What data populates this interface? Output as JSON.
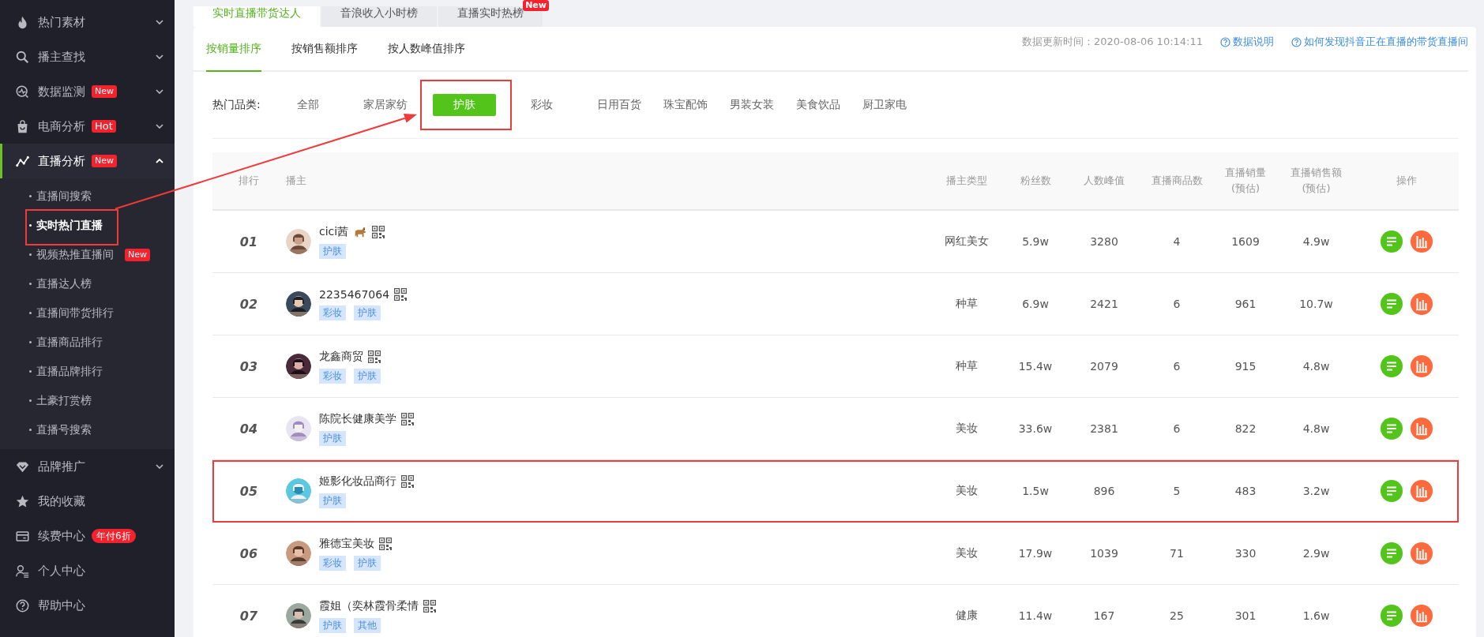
{
  "sidebar": {
    "items": [
      {
        "label": "热门素材",
        "expandable": true,
        "expanded": false,
        "selected": false
      },
      {
        "label": "播主查找",
        "expandable": true,
        "expanded": false,
        "selected": false
      },
      {
        "label": "数据监测",
        "badge": {
          "text": "New",
          "kind": "new"
        },
        "expandable": true,
        "expanded": false,
        "selected": false
      },
      {
        "label": "电商分析",
        "badge": {
          "text": "Hot",
          "kind": "hot"
        },
        "expandable": true,
        "expanded": false,
        "selected": false
      },
      {
        "label": "直播分析",
        "badge": {
          "text": "New",
          "kind": "new"
        },
        "expandable": true,
        "expanded": true,
        "selected": true,
        "children": [
          {
            "label": "直播间搜索",
            "selected": false,
            "highlighted": false
          },
          {
            "label": "实时热门直播",
            "selected": true,
            "highlighted": true
          },
          {
            "label": "视频热推直播间",
            "badge": {
              "text": "New",
              "kind": "new"
            },
            "selected": false,
            "highlighted": false
          },
          {
            "label": "直播达人榜",
            "selected": false,
            "highlighted": false
          },
          {
            "label": "直播间带货排行",
            "selected": false,
            "highlighted": false
          },
          {
            "label": "直播商品排行",
            "selected": false,
            "highlighted": false
          },
          {
            "label": "直播品牌排行",
            "selected": false,
            "highlighted": false
          },
          {
            "label": "土豪打赏榜",
            "selected": false,
            "highlighted": false
          },
          {
            "label": "直播号搜索",
            "selected": false,
            "highlighted": false
          }
        ]
      },
      {
        "label": "品牌推广",
        "expandable": true,
        "expanded": false,
        "selected": false
      },
      {
        "label": "我的收藏",
        "expandable": false,
        "selected": false
      },
      {
        "label": "续费中心",
        "badge": {
          "text": "年付6折",
          "kind": "promo"
        },
        "expandable": false,
        "selected": false
      },
      {
        "label": "个人中心",
        "expandable": false,
        "selected": false
      },
      {
        "label": "帮助中心",
        "expandable": false,
        "selected": false
      }
    ]
  },
  "tabs": [
    {
      "label": "实时直播带货达人",
      "selected": true
    },
    {
      "label": "音浪收入小时榜",
      "selected": false
    },
    {
      "label": "直播实时热榜",
      "selected": false,
      "badge": "New"
    }
  ],
  "sort_tabs": [
    {
      "label": "按销量排序",
      "selected": true
    },
    {
      "label": "按销售额排序",
      "selected": false
    },
    {
      "label": "按人数峰值排序",
      "selected": false
    }
  ],
  "update_info": "数据更新时间：2020-08-06 10:14:11",
  "help_links": [
    "数据说明",
    "如何发现抖音正在直播的带货直播间"
  ],
  "categories": {
    "label": "热门品类:",
    "items": [
      {
        "label": "全部",
        "selected": false,
        "highlighted": false
      },
      {
        "label": "家居家纺",
        "selected": false,
        "highlighted": false
      },
      {
        "label": "护肤",
        "selected": true,
        "highlighted": true
      },
      {
        "label": "彩妆",
        "selected": false,
        "highlighted": false
      },
      {
        "label": "日用百货",
        "selected": false,
        "highlighted": false
      },
      {
        "label": "珠宝配饰",
        "selected": false,
        "highlighted": false
      },
      {
        "label": "男装女装",
        "selected": false,
        "highlighted": false
      },
      {
        "label": "美食饮品",
        "selected": false,
        "highlighted": false
      },
      {
        "label": "厨卫家电",
        "selected": false,
        "highlighted": false
      }
    ]
  },
  "table": {
    "columns": [
      "排行",
      "播主",
      "播主类型",
      "粉丝数",
      "人数峰值",
      "直播商品数",
      "直播销量\n(预估)",
      "直播销售额\n(预估)",
      "操作"
    ],
    "rows": [
      {
        "rank": "01",
        "name": "cici茜",
        "emoji_icon": true,
        "tags": [
          "护肤"
        ],
        "type": "网红美女",
        "fans": "5.9w",
        "peak": "3280",
        "products": "4",
        "sales": "1609",
        "revenue": "4.9w",
        "highlighted": false
      },
      {
        "rank": "02",
        "name": "2235467064",
        "emoji_icon": false,
        "tags": [
          "彩妆",
          "护肤"
        ],
        "type": "种草",
        "fans": "6.9w",
        "peak": "2421",
        "products": "6",
        "sales": "961",
        "revenue": "10.7w",
        "highlighted": false
      },
      {
        "rank": "03",
        "name": "龙鑫商贸",
        "emoji_icon": false,
        "tags": [
          "彩妆",
          "护肤"
        ],
        "type": "种草",
        "fans": "15.4w",
        "peak": "2079",
        "products": "6",
        "sales": "915",
        "revenue": "4.8w",
        "highlighted": false
      },
      {
        "rank": "04",
        "name": "陈院长健康美学",
        "emoji_icon": false,
        "tags": [
          "护肤"
        ],
        "type": "美妆",
        "fans": "33.6w",
        "peak": "2381",
        "products": "6",
        "sales": "822",
        "revenue": "4.8w",
        "highlighted": false
      },
      {
        "rank": "05",
        "name": "姬影化妆品商行",
        "emoji_icon": false,
        "tags": [
          "护肤"
        ],
        "type": "美妆",
        "fans": "1.5w",
        "peak": "896",
        "products": "5",
        "sales": "483",
        "revenue": "3.2w",
        "highlighted": true
      },
      {
        "rank": "06",
        "name": "雅德宝美妆",
        "emoji_icon": false,
        "tags": [
          "彩妆",
          "护肤"
        ],
        "type": "美妆",
        "fans": "17.9w",
        "peak": "1039",
        "products": "71",
        "sales": "330",
        "revenue": "2.9w",
        "highlighted": false
      },
      {
        "rank": "07",
        "name": "霞姐（奕林霞骨柔情",
        "emoji_icon": false,
        "tags": [
          "护肤",
          "其他"
        ],
        "type": "健康",
        "fans": "11.4w",
        "peak": "167",
        "products": "25",
        "sales": "301",
        "revenue": "1.6w",
        "highlighted": false
      }
    ]
  }
}
